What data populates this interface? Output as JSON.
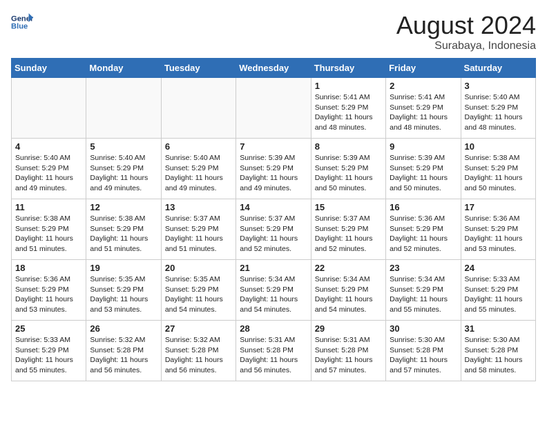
{
  "header": {
    "logo_line1": "General",
    "logo_line2": "Blue",
    "title": "August 2024",
    "subtitle": "Surabaya, Indonesia"
  },
  "weekdays": [
    "Sunday",
    "Monday",
    "Tuesday",
    "Wednesday",
    "Thursday",
    "Friday",
    "Saturday"
  ],
  "weeks": [
    [
      {
        "day": "",
        "text": ""
      },
      {
        "day": "",
        "text": ""
      },
      {
        "day": "",
        "text": ""
      },
      {
        "day": "",
        "text": ""
      },
      {
        "day": "1",
        "text": "Sunrise: 5:41 AM\nSunset: 5:29 PM\nDaylight: 11 hours\nand 48 minutes."
      },
      {
        "day": "2",
        "text": "Sunrise: 5:41 AM\nSunset: 5:29 PM\nDaylight: 11 hours\nand 48 minutes."
      },
      {
        "day": "3",
        "text": "Sunrise: 5:40 AM\nSunset: 5:29 PM\nDaylight: 11 hours\nand 48 minutes."
      }
    ],
    [
      {
        "day": "4",
        "text": "Sunrise: 5:40 AM\nSunset: 5:29 PM\nDaylight: 11 hours\nand 49 minutes."
      },
      {
        "day": "5",
        "text": "Sunrise: 5:40 AM\nSunset: 5:29 PM\nDaylight: 11 hours\nand 49 minutes."
      },
      {
        "day": "6",
        "text": "Sunrise: 5:40 AM\nSunset: 5:29 PM\nDaylight: 11 hours\nand 49 minutes."
      },
      {
        "day": "7",
        "text": "Sunrise: 5:39 AM\nSunset: 5:29 PM\nDaylight: 11 hours\nand 49 minutes."
      },
      {
        "day": "8",
        "text": "Sunrise: 5:39 AM\nSunset: 5:29 PM\nDaylight: 11 hours\nand 50 minutes."
      },
      {
        "day": "9",
        "text": "Sunrise: 5:39 AM\nSunset: 5:29 PM\nDaylight: 11 hours\nand 50 minutes."
      },
      {
        "day": "10",
        "text": "Sunrise: 5:38 AM\nSunset: 5:29 PM\nDaylight: 11 hours\nand 50 minutes."
      }
    ],
    [
      {
        "day": "11",
        "text": "Sunrise: 5:38 AM\nSunset: 5:29 PM\nDaylight: 11 hours\nand 51 minutes."
      },
      {
        "day": "12",
        "text": "Sunrise: 5:38 AM\nSunset: 5:29 PM\nDaylight: 11 hours\nand 51 minutes."
      },
      {
        "day": "13",
        "text": "Sunrise: 5:37 AM\nSunset: 5:29 PM\nDaylight: 11 hours\nand 51 minutes."
      },
      {
        "day": "14",
        "text": "Sunrise: 5:37 AM\nSunset: 5:29 PM\nDaylight: 11 hours\nand 52 minutes."
      },
      {
        "day": "15",
        "text": "Sunrise: 5:37 AM\nSunset: 5:29 PM\nDaylight: 11 hours\nand 52 minutes."
      },
      {
        "day": "16",
        "text": "Sunrise: 5:36 AM\nSunset: 5:29 PM\nDaylight: 11 hours\nand 52 minutes."
      },
      {
        "day": "17",
        "text": "Sunrise: 5:36 AM\nSunset: 5:29 PM\nDaylight: 11 hours\nand 53 minutes."
      }
    ],
    [
      {
        "day": "18",
        "text": "Sunrise: 5:36 AM\nSunset: 5:29 PM\nDaylight: 11 hours\nand 53 minutes."
      },
      {
        "day": "19",
        "text": "Sunrise: 5:35 AM\nSunset: 5:29 PM\nDaylight: 11 hours\nand 53 minutes."
      },
      {
        "day": "20",
        "text": "Sunrise: 5:35 AM\nSunset: 5:29 PM\nDaylight: 11 hours\nand 54 minutes."
      },
      {
        "day": "21",
        "text": "Sunrise: 5:34 AM\nSunset: 5:29 PM\nDaylight: 11 hours\nand 54 minutes."
      },
      {
        "day": "22",
        "text": "Sunrise: 5:34 AM\nSunset: 5:29 PM\nDaylight: 11 hours\nand 54 minutes."
      },
      {
        "day": "23",
        "text": "Sunrise: 5:34 AM\nSunset: 5:29 PM\nDaylight: 11 hours\nand 55 minutes."
      },
      {
        "day": "24",
        "text": "Sunrise: 5:33 AM\nSunset: 5:29 PM\nDaylight: 11 hours\nand 55 minutes."
      }
    ],
    [
      {
        "day": "25",
        "text": "Sunrise: 5:33 AM\nSunset: 5:29 PM\nDaylight: 11 hours\nand 55 minutes."
      },
      {
        "day": "26",
        "text": "Sunrise: 5:32 AM\nSunset: 5:28 PM\nDaylight: 11 hours\nand 56 minutes."
      },
      {
        "day": "27",
        "text": "Sunrise: 5:32 AM\nSunset: 5:28 PM\nDaylight: 11 hours\nand 56 minutes."
      },
      {
        "day": "28",
        "text": "Sunrise: 5:31 AM\nSunset: 5:28 PM\nDaylight: 11 hours\nand 56 minutes."
      },
      {
        "day": "29",
        "text": "Sunrise: 5:31 AM\nSunset: 5:28 PM\nDaylight: 11 hours\nand 57 minutes."
      },
      {
        "day": "30",
        "text": "Sunrise: 5:30 AM\nSunset: 5:28 PM\nDaylight: 11 hours\nand 57 minutes."
      },
      {
        "day": "31",
        "text": "Sunrise: 5:30 AM\nSunset: 5:28 PM\nDaylight: 11 hours\nand 58 minutes."
      }
    ]
  ]
}
